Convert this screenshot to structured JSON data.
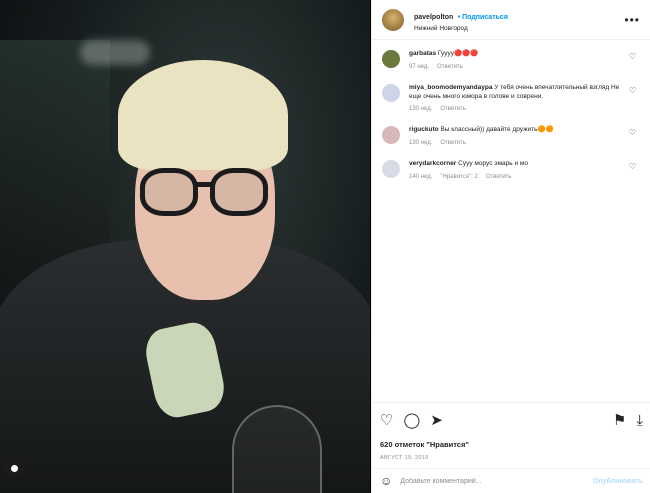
{
  "post": {
    "username": "pavelpolton",
    "follow_label": "Подписаться",
    "location": "Нижний Новгород",
    "more_icon": "more-dots-icon",
    "comments": [
      {
        "username": "garbatas",
        "text": "Гуууу🔴🔴🔴",
        "age": "97 нед.",
        "reply": "Ответить",
        "likes": "",
        "avatar_color": "#6b7a3c"
      },
      {
        "username": "miya_boomodemyandaypa",
        "text": "У тебя очень впечатлительный взгляд Не еще очень много юмора в голове и соврени.",
        "age": "130 нед.",
        "reply": "Ответить",
        "likes": "",
        "avatar_color": "#cfd4e6"
      },
      {
        "username": "riguckuto",
        "text": "Вы классный)) давайте дружить🟠🟠",
        "age": "130 нед.",
        "reply": "Ответить",
        "likes": "",
        "avatar_color": "#d8b9b9"
      },
      {
        "username": "verydarkcorner",
        "text": "Сууу морус эмарь и мо",
        "age": "140 нед.",
        "reply": "Ответить",
        "likes": "\"Нравится\": 2",
        "avatar_color": "#d7dbe6"
      }
    ],
    "likes_text": "620 отметок \"Нравится\"",
    "date": "АВГУСТ 19, 2019",
    "comment_placeholder": "Добавьте комментарий...",
    "publish_label": "Опубликовать"
  }
}
